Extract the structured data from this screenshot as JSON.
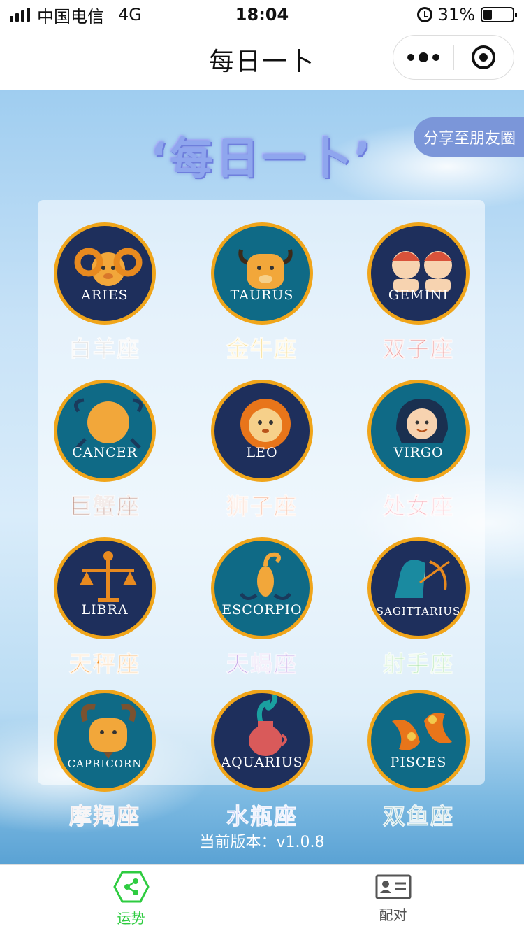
{
  "status_bar": {
    "carrier": "中国电信",
    "network": "4G",
    "time": "18:04",
    "battery": "31%",
    "battery_level": 0.31
  },
  "nav": {
    "title": "每日一卜",
    "more_icon": "more-dots-icon",
    "close_icon": "target-close-icon"
  },
  "main": {
    "headline": "‘每日一卜’",
    "share_label": "分享至朋友圈",
    "version": "当前版本：v1.0.8"
  },
  "signs": [
    {
      "en": "ARIES",
      "cn": "白羊座",
      "bg": "#1e2f5c",
      "label_color": "#c9c9c9",
      "icon": "ram-icon"
    },
    {
      "en": "TAURUS",
      "cn": "金牛座",
      "bg": "#0f6a86",
      "label_color": "#f2c94c",
      "icon": "bull-icon"
    },
    {
      "en": "GEMINI",
      "cn": "双子座",
      "bg": "#1e2f5c",
      "label_color": "#e05a5a",
      "icon": "twins-icon"
    },
    {
      "en": "CANCER",
      "cn": "巨蟹座",
      "bg": "#0f6a86",
      "label_color": "#8a3d2a",
      "icon": "crab-icon"
    },
    {
      "en": "LEO",
      "cn": "狮子座",
      "bg": "#1e2f5c",
      "label_color": "#f08a5d",
      "icon": "lion-icon"
    },
    {
      "en": "VIRGO",
      "cn": "处女座",
      "bg": "#0f6a86",
      "label_color": "#f6a6b2",
      "icon": "maiden-icon"
    },
    {
      "en": "LIBRA",
      "cn": "天秤座",
      "bg": "#1e2f5c",
      "label_color": "#f28c1a",
      "icon": "scales-icon"
    },
    {
      "en": "ESCORPIO",
      "cn": "天蝎座",
      "bg": "#0f6a86",
      "label_color": "#9b6ad6",
      "icon": "scorpion-icon"
    },
    {
      "en": "SAGITTARIUS",
      "cn": "射手座",
      "bg": "#1e2f5c",
      "label_color": "#7ed67e",
      "icon": "archer-icon"
    },
    {
      "en": "CAPRICORN",
      "cn": "摩羯座",
      "bg": "#0f6a86",
      "label_color": "#b59aa6",
      "icon": "goat-icon"
    },
    {
      "en": "AQUARIUS",
      "cn": "水瓶座",
      "bg": "#1e2f5c",
      "label_color": "#8fa6ee",
      "icon": "water-jar-icon"
    },
    {
      "en": "PISCES",
      "cn": "双鱼座",
      "bg": "#0f6a86",
      "label_color": "#1b7a8c",
      "icon": "fish-icon"
    }
  ],
  "tabs": [
    {
      "label": "运势",
      "active": true,
      "color": "#2ecc40",
      "icon": "share-hexagon-icon"
    },
    {
      "label": "配对",
      "active": false,
      "color": "#555555",
      "icon": "id-card-icon"
    }
  ]
}
